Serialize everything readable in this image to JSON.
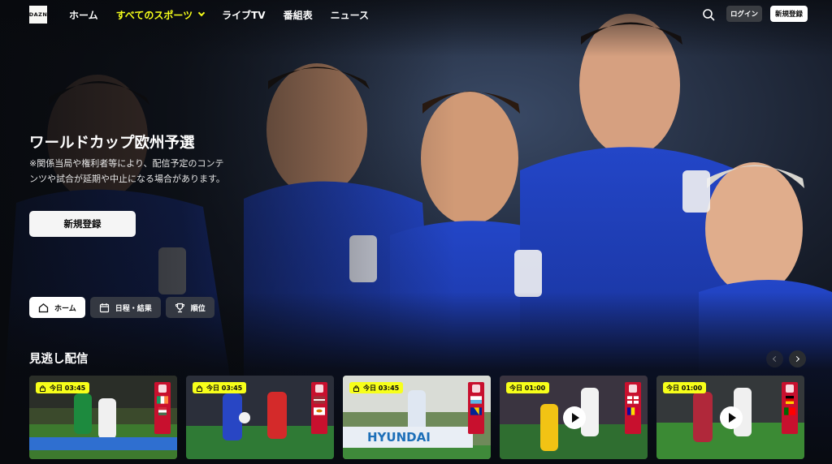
{
  "header": {
    "logo": "DAZN",
    "nav": [
      {
        "label": "ホーム"
      },
      {
        "label": "すべてのスポーツ"
      },
      {
        "label": "ライブTV"
      },
      {
        "label": "番組表"
      },
      {
        "label": "ニュース"
      }
    ],
    "login_label": "ログイン",
    "register_label": "新規登録"
  },
  "hero": {
    "title": "ワールドカップ欧州予選",
    "note": "※関係当局や権利者等により、配信予定のコンテンツや試合が延期や中止になる場合があります。",
    "cta_label": "新規登録"
  },
  "tabs": [
    {
      "label": "ホーム",
      "icon": "home-icon"
    },
    {
      "label": "日程・結果",
      "icon": "calendar-icon"
    },
    {
      "label": "順位",
      "icon": "trophy-icon"
    }
  ],
  "section": {
    "title": "見逃し配信"
  },
  "cards": [
    {
      "badge": "今日 03:45",
      "locked": true,
      "play": false
    },
    {
      "badge": "今日 03:45",
      "locked": true,
      "play": false
    },
    {
      "badge": "今日 03:45",
      "locked": true,
      "play": false,
      "board_text": "HYUNDAI"
    },
    {
      "badge": "今日 01:00",
      "locked": false,
      "play": true
    },
    {
      "badge": "今日 01:00",
      "locked": false,
      "play": true
    }
  ],
  "colors": {
    "accent": "#f7ff1a",
    "jersey": "#1d3fb8",
    "uefa_red": "#c8102e"
  }
}
